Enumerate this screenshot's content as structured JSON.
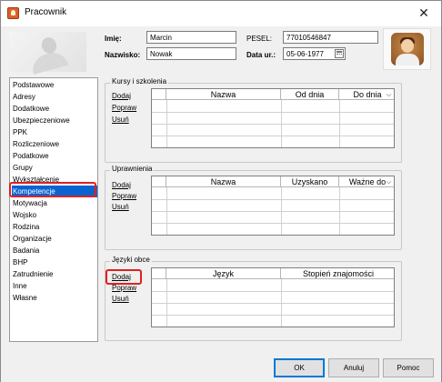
{
  "window": {
    "title": "Pracownik",
    "close_glyph": "✕",
    "icon": "app-person-icon"
  },
  "header": {
    "first_name_label": "Imię:",
    "first_name_value": "Marcin",
    "last_name_label": "Nazwisko:",
    "last_name_value": "Nowak",
    "pesel_label": "PESEL:",
    "pesel_value": "77010546847",
    "birth_date_label": "Data ur.:",
    "birth_date_value": "05-06-1977",
    "calendar_icon": "calendar-icon"
  },
  "sidebar": {
    "selected_index": 15,
    "items": [
      "Podstawowe",
      "Adresy",
      "Dodatkowe",
      "Ubezpieczeniowe",
      "PPK",
      "Rozliczeniowe",
      "Podatkowe",
      "Grupy",
      "Wykształcenie",
      "Kompetencje",
      "Motywacja",
      "Wojsko",
      "Rodzina",
      "Organizacje",
      "Badania",
      "BHP",
      "Zatrudnienie",
      "Inne",
      "Własne"
    ]
  },
  "sections": {
    "courses": {
      "title": "Kursy i szkolenia",
      "actions": [
        "Dodaj",
        "Popraw",
        "Usuń"
      ],
      "columns": [
        "Nazwa",
        "Od dnia",
        "Do dnia"
      ]
    },
    "permissions": {
      "title": "Uprawnienia",
      "actions": [
        "Dodaj",
        "Popraw",
        "Usuń"
      ],
      "columns": [
        "Nazwa",
        "Uzyskano",
        "Ważne do"
      ]
    },
    "languages": {
      "title": "Języki obce",
      "actions": [
        "Dodaj",
        "Popraw",
        "Usuń"
      ],
      "columns": [
        "Język",
        "Stopień znajomości"
      ]
    }
  },
  "footer": {
    "ok_label": "OK",
    "cancel_label": "Anuluj",
    "help_label": "Pomoc"
  },
  "colors": {
    "selection": "#0a63d1",
    "highlight_outline": "#e02020",
    "default_button_border": "#0078d7"
  }
}
